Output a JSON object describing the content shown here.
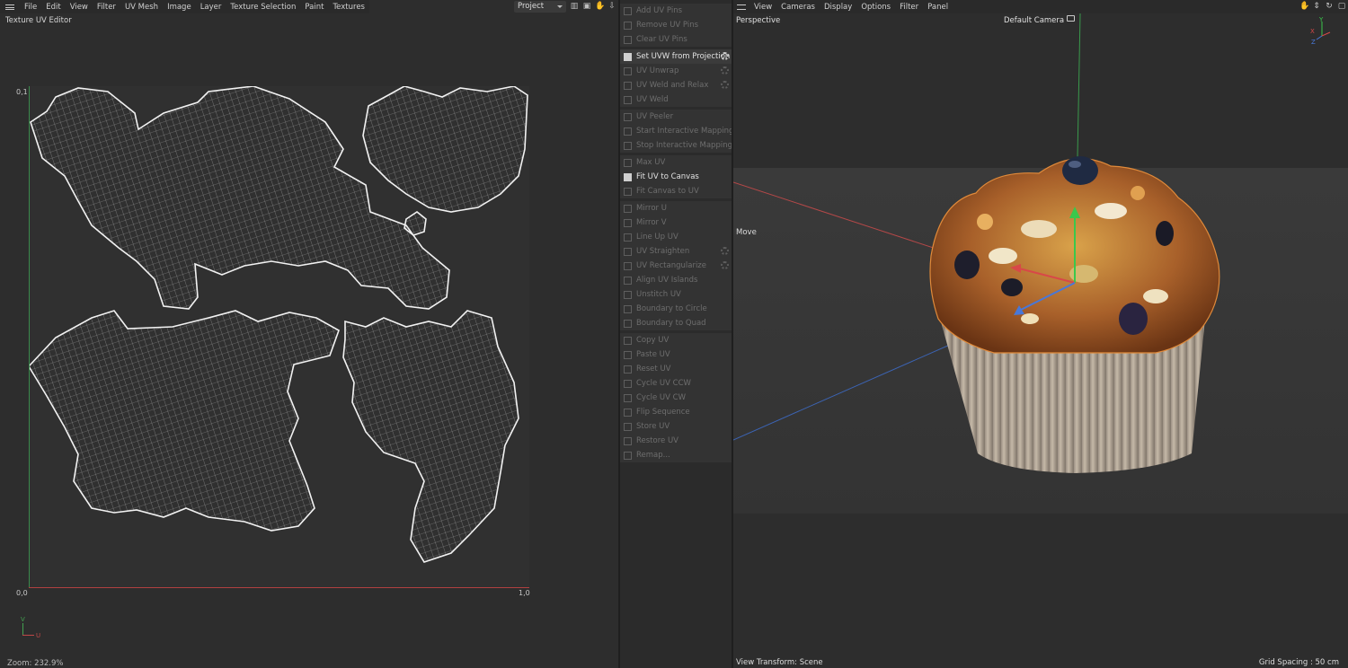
{
  "uv_editor": {
    "menu": [
      "File",
      "Edit",
      "View",
      "Filter",
      "UV Mesh",
      "Image",
      "Layer",
      "Texture Selection",
      "Paint",
      "Textures"
    ],
    "title": "Texture UV Editor",
    "project_select": "Project",
    "corner_labels": {
      "top_left": "0,1",
      "bottom_left": "0,0",
      "bottom_right": "1,0"
    },
    "gizmo": {
      "v": "V",
      "u": "U"
    },
    "zoom": "Zoom: 232.9%"
  },
  "commands": {
    "groups": [
      [
        {
          "label": "Add UV Pins",
          "enabled": false,
          "icon": "pin-add-icon",
          "gear": false
        },
        {
          "label": "Remove UV Pins",
          "enabled": false,
          "icon": "pin-remove-icon",
          "gear": false
        },
        {
          "label": "Clear UV Pins",
          "enabled": false,
          "icon": "pin-clear-icon",
          "gear": false
        }
      ],
      [
        {
          "label": "Set UVW from Projection",
          "enabled": true,
          "icon": "projection-icon",
          "gear": true
        },
        {
          "label": "UV Unwrap",
          "enabled": false,
          "icon": "unwrap-icon",
          "gear": true
        },
        {
          "label": "UV Weld and Relax",
          "enabled": false,
          "icon": "weld-relax-icon",
          "gear": true
        },
        {
          "label": "UV Weld",
          "enabled": false,
          "icon": "weld-icon",
          "gear": false
        }
      ],
      [
        {
          "label": "UV Peeler",
          "enabled": false,
          "icon": "peeler-icon",
          "gear": false
        },
        {
          "label": "Start Interactive Mapping",
          "enabled": false,
          "icon": "play-icon",
          "gear": false
        },
        {
          "label": "Stop Interactive Mapping",
          "enabled": false,
          "icon": "stop-icon",
          "gear": false
        }
      ],
      [
        {
          "label": "Max UV",
          "enabled": false,
          "icon": "max-uv-icon",
          "gear": false
        },
        {
          "label": "Fit UV to Canvas",
          "enabled": true,
          "icon": "fit-uv-icon",
          "gear": false
        },
        {
          "label": "Fit Canvas to UV",
          "enabled": false,
          "icon": "fit-canvas-icon",
          "gear": false
        }
      ],
      [
        {
          "label": "Mirror U",
          "enabled": false,
          "icon": "mirror-u-icon",
          "gear": false
        },
        {
          "label": "Mirror V",
          "enabled": false,
          "icon": "mirror-v-icon",
          "gear": false
        },
        {
          "label": "Line Up UV",
          "enabled": false,
          "icon": "line-up-icon",
          "gear": false
        },
        {
          "label": "UV Straighten",
          "enabled": false,
          "icon": "straighten-icon",
          "gear": true
        },
        {
          "label": "UV Rectangularize",
          "enabled": false,
          "icon": "rectangularize-icon",
          "gear": true
        },
        {
          "label": "Align UV Islands",
          "enabled": false,
          "icon": "align-icon",
          "gear": false
        },
        {
          "label": "Unstitch UV",
          "enabled": false,
          "icon": "unstitch-icon",
          "gear": false
        },
        {
          "label": "Boundary to Circle",
          "enabled": false,
          "icon": "circle-icon",
          "gear": false
        },
        {
          "label": "Boundary to Quad",
          "enabled": false,
          "icon": "quad-icon",
          "gear": false
        }
      ],
      [
        {
          "label": "Copy UV",
          "enabled": false,
          "icon": "copy-icon",
          "gear": false
        },
        {
          "label": "Paste UV",
          "enabled": false,
          "icon": "paste-icon",
          "gear": false
        },
        {
          "label": "Reset UV",
          "enabled": false,
          "icon": "reset-icon",
          "gear": false
        },
        {
          "label": "Cycle UV CCW",
          "enabled": false,
          "icon": "cycle-ccw-icon",
          "gear": false
        },
        {
          "label": "Cycle UV CW",
          "enabled": false,
          "icon": "cycle-cw-icon",
          "gear": false
        },
        {
          "label": "Flip Sequence",
          "enabled": false,
          "icon": "flip-icon",
          "gear": false
        },
        {
          "label": "Store UV",
          "enabled": false,
          "icon": "store-icon",
          "gear": false
        },
        {
          "label": "Restore UV",
          "enabled": false,
          "icon": "restore-icon",
          "gear": false
        },
        {
          "label": "Remap...",
          "enabled": false,
          "icon": "remap-icon",
          "gear": false
        }
      ]
    ]
  },
  "viewport": {
    "menu": [
      "View",
      "Cameras",
      "Display",
      "Options",
      "Filter",
      "Panel"
    ],
    "name": "Perspective",
    "camera": "Default Camera",
    "tool": "Move",
    "view_transform": "View Transform: Scene",
    "grid_spacing": "Grid Spacing : 50 cm",
    "gizmo": {
      "y": "Y",
      "x": "X",
      "z": "Z"
    }
  },
  "colors": {
    "uv_wire": "#e6e6e6",
    "axis_u": "#b04040",
    "axis_v": "#3a8a4c",
    "muffin_top": "#a8602a",
    "wrapper": "#b7aa9b",
    "selection_outline": "#e08a3a"
  }
}
